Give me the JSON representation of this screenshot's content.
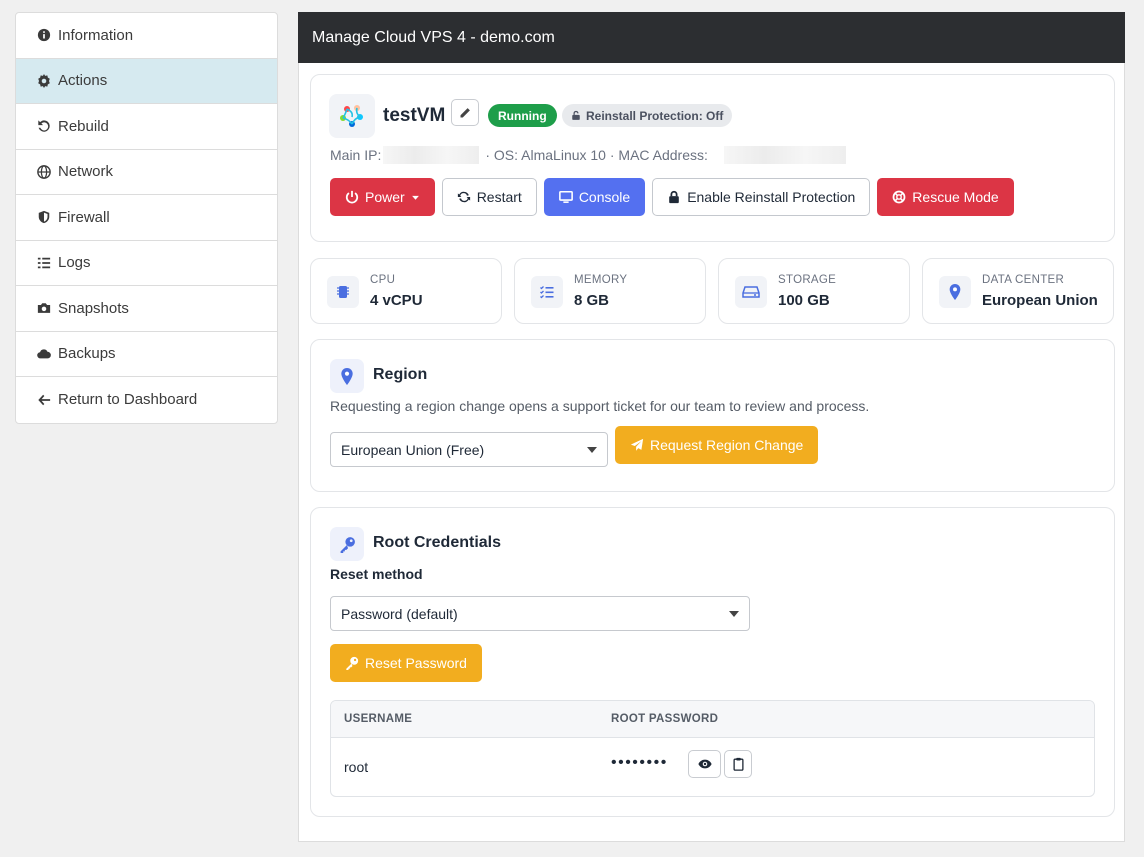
{
  "sidebar": {
    "items": [
      {
        "label": "Information",
        "icon": "info-circle-icon"
      },
      {
        "label": "Actions",
        "icon": "gear-icon",
        "active": true
      },
      {
        "label": "Rebuild",
        "icon": "rotate-left-icon"
      },
      {
        "label": "Network",
        "icon": "globe-icon"
      },
      {
        "label": "Firewall",
        "icon": "shield-icon"
      },
      {
        "label": "Logs",
        "icon": "list-check-icon"
      },
      {
        "label": "Snapshots",
        "icon": "camera-icon"
      },
      {
        "label": "Backups",
        "icon": "cloud-icon"
      },
      {
        "label": "Return to Dashboard",
        "icon": "arrow-left-icon"
      }
    ]
  },
  "header": {
    "title": "Manage Cloud VPS 4 - demo.com"
  },
  "vm": {
    "name": "testVM",
    "status": "Running",
    "protection_badge": "Reinstall Protection: Off",
    "main_ip_label": "Main IP:",
    "os_text": "· OS: AlmaLinux 10 · MAC Address:",
    "actions": {
      "power": "Power",
      "restart": "Restart",
      "console": "Console",
      "enable_protection": "Enable Reinstall Protection",
      "rescue": "Rescue Mode"
    }
  },
  "stats": [
    {
      "label": "CPU",
      "value": "4 vCPU",
      "icon": "chip-icon"
    },
    {
      "label": "MEMORY",
      "value": "8 GB",
      "icon": "memory-list-icon"
    },
    {
      "label": "STORAGE",
      "value": "100 GB",
      "icon": "hard-drive-icon"
    },
    {
      "label": "DATA CENTER",
      "value": "European Union",
      "icon": "location-pin-icon"
    }
  ],
  "region": {
    "title": "Region",
    "description": "Requesting a region change opens a support ticket for our team to review and process.",
    "selected": "European Union (Free)",
    "button": "Request Region Change"
  },
  "credentials": {
    "title": "Root Credentials",
    "method_label": "Reset method",
    "method_selected": "Password (default)",
    "reset_button": "Reset Password",
    "columns": [
      "USERNAME",
      "ROOT PASSWORD"
    ],
    "username": "root",
    "password_masked": "••••••••"
  },
  "colors": {
    "header_bg": "#2c2e31",
    "active_sidebar": "#d6eaf0",
    "running_green": "#1e9e4a",
    "danger_red": "#dc3545",
    "console_blue": "#5470f0",
    "warning_yellow": "#f2ad1f",
    "icon_blue": "#4a6ee0"
  }
}
